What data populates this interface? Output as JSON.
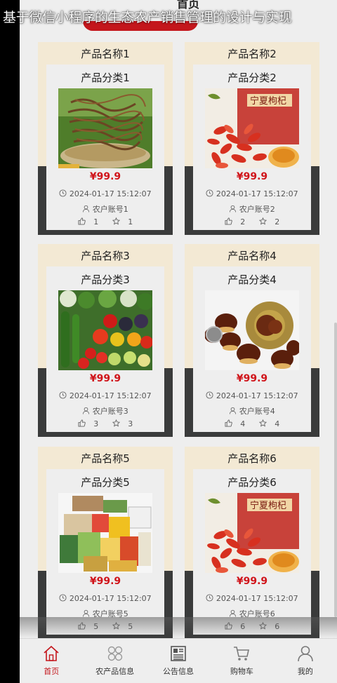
{
  "overlay_title": "基于微信小程序的生态农产销售管理的设计与实现",
  "nav": {
    "title": "首页"
  },
  "products": [
    {
      "name": "产品名称1",
      "category": "产品分类1",
      "price": "¥99.9",
      "time": "2024-01-17 15:12:07",
      "account": "农户账号1",
      "likes": "1",
      "favorites": "1",
      "image": "dried-vegetable-image"
    },
    {
      "name": "产品名称2",
      "category": "产品分类2",
      "price": "¥99.9",
      "time": "2024-01-17 15:12:07",
      "account": "农户账号2",
      "likes": "2",
      "favorites": "2",
      "image": "goji-berry-image"
    },
    {
      "name": "产品名称3",
      "category": "产品分类3",
      "price": "¥99.9",
      "time": "2024-01-17 15:12:07",
      "account": "农户账号3",
      "likes": "3",
      "favorites": "3",
      "image": "vegetables-image"
    },
    {
      "name": "产品名称4",
      "category": "产品分类4",
      "price": "¥99.9",
      "time": "2024-01-17 15:12:07",
      "account": "农户账号4",
      "likes": "4",
      "favorites": "4",
      "image": "chestnut-image"
    },
    {
      "name": "产品名称5",
      "category": "产品分类5",
      "price": "¥99.9",
      "time": "2024-01-17 15:12:07",
      "account": "农户账号5",
      "likes": "5",
      "favorites": "5",
      "image": "gift-box-image"
    },
    {
      "name": "产品名称6",
      "category": "产品分类6",
      "price": "¥99.9",
      "time": "2024-01-17 15:12:07",
      "account": "农户账号6",
      "likes": "6",
      "favorites": "6",
      "image": "goji-berry-image"
    }
  ],
  "tabs": [
    {
      "label": "首页",
      "icon": "home-icon",
      "active": true
    },
    {
      "label": "农产品信息",
      "icon": "grid-icon",
      "active": false
    },
    {
      "label": "公告信息",
      "icon": "news-icon",
      "active": false
    },
    {
      "label": "购物车",
      "icon": "cart-icon",
      "active": false
    },
    {
      "label": "我的",
      "icon": "user-icon",
      "active": false
    }
  ],
  "colors": {
    "accent": "#c4161c",
    "price": "#d0141a",
    "card_bg": "#f3e9d4",
    "card_band": "#3a3b3b"
  }
}
